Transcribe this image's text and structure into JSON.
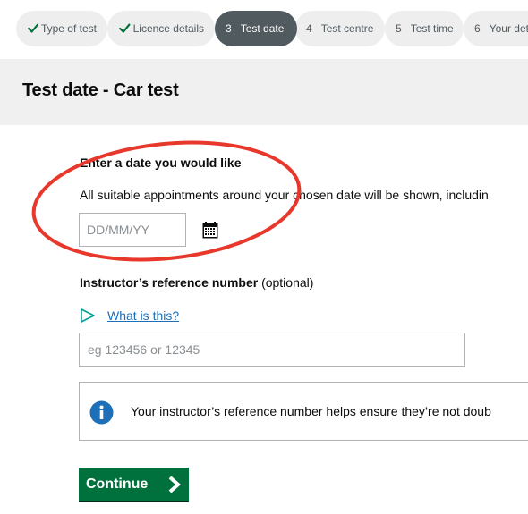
{
  "progress": {
    "steps": [
      {
        "number": "",
        "label": "Type of test",
        "state": "done"
      },
      {
        "number": "",
        "label": "Licence details",
        "state": "done"
      },
      {
        "number": "3",
        "label": "Test date",
        "state": "active"
      },
      {
        "number": "4",
        "label": "Test centre",
        "state": "todo"
      },
      {
        "number": "5",
        "label": "Test time",
        "state": "todo"
      },
      {
        "number": "6",
        "label": "Your det",
        "state": "todo"
      }
    ]
  },
  "header": {
    "title": "Test date - Car test"
  },
  "date": {
    "label": "Enter a date you would like",
    "hint": "All suitable appointments around your chosen date will be shown, includin",
    "placeholder": "DD/MM/YY",
    "icon": "calendar-icon"
  },
  "instructor": {
    "label_bold": "Instructor’s reference number",
    "label_optional": "(optional)",
    "help_link": "What is this?",
    "placeholder": "eg 123456 or 12345"
  },
  "info": {
    "text": "Your instructor’s reference number helps ensure they’re not doub",
    "icon": "info-icon"
  },
  "actions": {
    "continue_label": "Continue"
  },
  "colors": {
    "accent_green": "#00703c",
    "link_blue": "#1d70b8",
    "annotation_red": "#e8372b",
    "tick_green": "#00703c"
  }
}
